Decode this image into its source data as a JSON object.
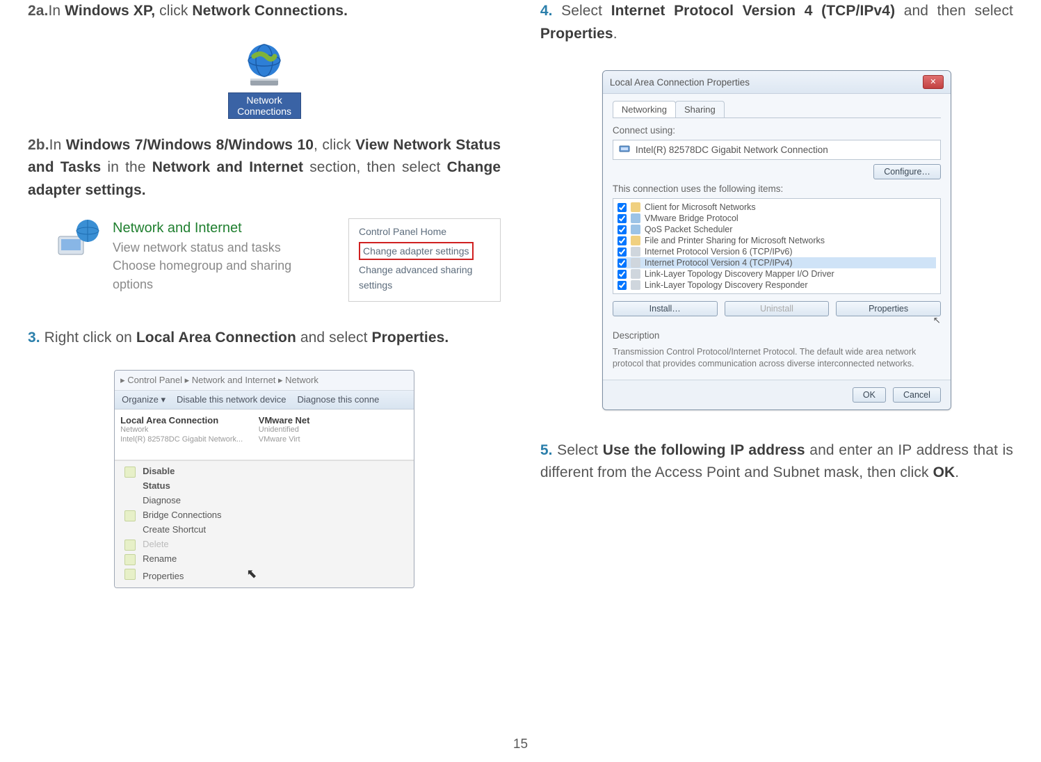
{
  "page_number": "15",
  "steps": {
    "s2a_num": "2a.",
    "s2a_pre": "In ",
    "s2a_bold": "Windows XP, ",
    "s2a_mid": "click ",
    "s2a_bold2": "Network Connections.",
    "s2b_num": "2b.",
    "s2b_pre": "In ",
    "s2b_os": "Windows 7/Windows 8/Windows 10",
    "s2b_mid1": ", click ",
    "s2b_link1": "View Network Status and Tasks",
    "s2b_mid2": " in the ",
    "s2b_link2": "Network and Internet",
    "s2b_mid3": " section, then select ",
    "s2b_link3": "Change adapter settings.",
    "s3_num": "3.",
    "s3_pre": "  Right click on ",
    "s3_b1": "Local Area Connection",
    "s3_mid": " and select ",
    "s3_b2": "Properties.",
    "s4_num": "4.",
    "s4_pre": "  Select ",
    "s4_b1": "Internet Protocol Version 4 (TCP/IPv4)",
    "s4_mid": " and then select ",
    "s4_b2": "Properties",
    "s4_end": ".",
    "s5_num": "5.",
    "s5_pre": "  Select ",
    "s5_b1": "Use the following IP address",
    "s5_mid": " and enter an IP address that is different from the Access Point and Subnet mask, then click ",
    "s5_b2": "OK",
    "s5_end": "."
  },
  "nc_icon": {
    "line1": "Network",
    "line2": "Connections"
  },
  "nai": {
    "heading": "Network and Internet",
    "line1": "View network status and tasks",
    "line2": "Choose homegroup and sharing options"
  },
  "cp_panel": {
    "home": "Control Panel Home",
    "adapter": "Change adapter settings",
    "adv1": "Change advanced sharing",
    "adv2": "settings"
  },
  "explorer": {
    "addr": "▸ Control Panel  ▸  Network and Internet  ▸  Network",
    "org": "Organize ▾",
    "disable": "Disable this network device",
    "diag": "Diagnose this conne",
    "item1_t": "Local Area Connection",
    "item1_s1": "Network",
    "item1_s2": "Intel(R) 82578DC Gigabit Network...",
    "item2_t": "VMware Net",
    "item2_s1": "Unidentified",
    "item2_s2": "VMware Virt",
    "menu": {
      "disable": "Disable",
      "status": "Status",
      "diagnose": "Diagnose",
      "bridge": "Bridge Connections",
      "shortcut": "Create Shortcut",
      "delete": "Delete",
      "rename": "Rename",
      "properties": "Properties"
    }
  },
  "dialog": {
    "title": "Local Area Connection Properties",
    "close": "✕",
    "tab1": "Networking",
    "tab2": "Sharing",
    "connect_using": "Connect using:",
    "adapter": "Intel(R) 82578DC Gigabit Network Connection",
    "configure": "Configure…",
    "uses_items": "This connection uses the following items:",
    "items": {
      "i0": "Client for Microsoft Networks",
      "i1": "VMware Bridge Protocol",
      "i2": "QoS Packet Scheduler",
      "i3": "File and Printer Sharing for Microsoft Networks",
      "i4": "Internet Protocol Version 6 (TCP/IPv6)",
      "i5": "Internet Protocol Version 4 (TCP/IPv4)",
      "i6": "Link-Layer Topology Discovery Mapper I/O Driver",
      "i7": "Link-Layer Topology Discovery Responder"
    },
    "install": "Install…",
    "uninstall": "Uninstall",
    "properties": "Properties",
    "description_label": "Description",
    "description": "Transmission Control Protocol/Internet Protocol. The default wide area network protocol that provides communication across diverse interconnected networks.",
    "ok": "OK",
    "cancel": "Cancel"
  }
}
